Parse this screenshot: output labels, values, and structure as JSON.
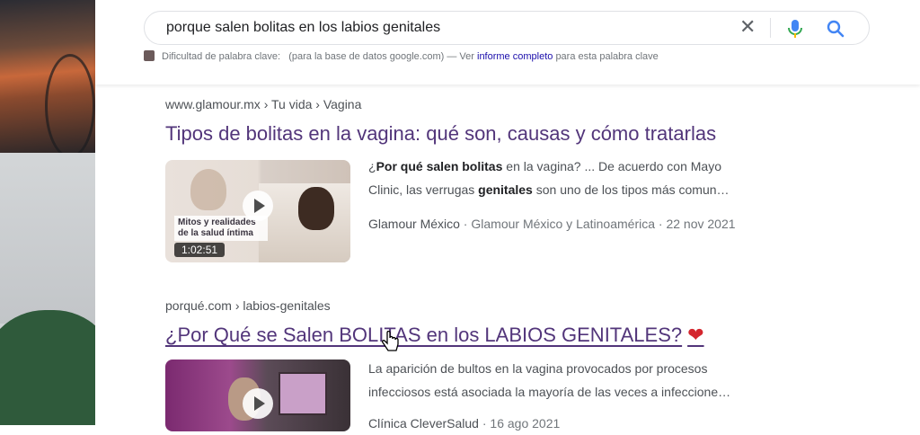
{
  "search": {
    "query": "porque salen bolitas en los labios genitales"
  },
  "keyword_bar": {
    "label": "Dificultad de palabra clave:",
    "note": "(para la base de datos google.com) — Ver",
    "link": "informe completo",
    "suffix": "para esta palabra clave"
  },
  "results": [
    {
      "cite": "www.glamour.mx › Tu vida › Vagina",
      "title": "Tipos de bolitas en la vagina: qué son, causas y cómo tratarlas",
      "thumb_caption": "Mitos y realidades de la salud íntima",
      "duration": "1:02:51",
      "snippet_1_pre": "¿",
      "snippet_1_bold": "Por qué salen bolitas",
      "snippet_1_post": " en la vagina? ... De acuerdo con Mayo",
      "snippet_2_pre": "Clinic, las verrugas ",
      "snippet_2_bold": "genitales",
      "snippet_2_post": " son uno de los tipos más comun…",
      "source": "Glamour México",
      "channel": "Glamour México y Latinoamérica",
      "date": "22 nov 2021"
    },
    {
      "cite": "porqué.com › labios-genitales",
      "title": "¿Por Qué se Salen BOLITAS en los LABIOS GENITALES?",
      "heart": "❤",
      "snippet_1": "La aparición de bultos en la vagina provocados por procesos",
      "snippet_2": "infecciosos está asociada la mayoría de las veces a infeccione…",
      "source": "Clínica CleverSalud",
      "date": "16 ago 2021"
    }
  ],
  "colors": {
    "link_visited": "#52357a",
    "heart": "#d4262e",
    "link_blue": "#1a0dab"
  }
}
